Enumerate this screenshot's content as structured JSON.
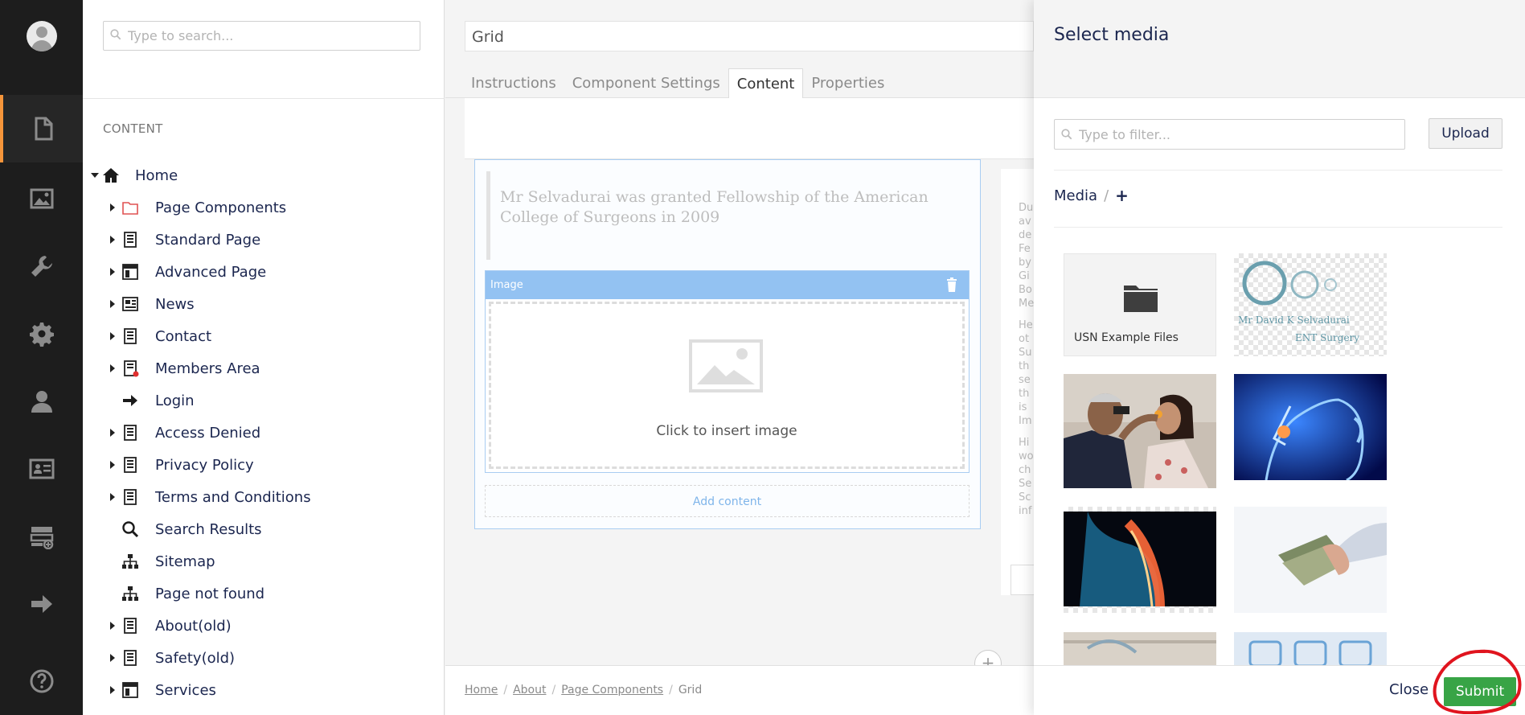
{
  "rail": {
    "items": [
      {
        "name": "content",
        "icon": "document-icon",
        "active": true
      },
      {
        "name": "media",
        "icon": "image-icon"
      },
      {
        "name": "settings",
        "icon": "wrench-icon"
      },
      {
        "name": "developer",
        "icon": "gear-icon"
      },
      {
        "name": "users",
        "icon": "user-icon"
      },
      {
        "name": "members",
        "icon": "id-card-icon"
      },
      {
        "name": "forms",
        "icon": "form-add-icon"
      },
      {
        "name": "redirects",
        "icon": "arrow-right-icon"
      },
      {
        "name": "help",
        "icon": "help-icon"
      }
    ],
    "accent_color": "#f5953a"
  },
  "tree": {
    "search_placeholder": "Type to search...",
    "heading": "CONTENT",
    "items": [
      {
        "label": "Home",
        "icon": "home-icon",
        "expanded": true
      },
      {
        "label": "Page Components",
        "icon": "folder-icon"
      },
      {
        "label": "Standard Page",
        "icon": "page-icon"
      },
      {
        "label": "Advanced Page",
        "icon": "layout-icon"
      },
      {
        "label": "News",
        "icon": "newspaper-icon"
      },
      {
        "label": "Contact",
        "icon": "page-icon"
      },
      {
        "label": "Members Area",
        "icon": "page-locked-icon"
      },
      {
        "label": "Login",
        "icon": "arrow-right-icon"
      },
      {
        "label": "Access Denied",
        "icon": "page-icon"
      },
      {
        "label": "Privacy Policy",
        "icon": "page-icon"
      },
      {
        "label": "Terms and Conditions",
        "icon": "page-icon"
      },
      {
        "label": "Search Results",
        "icon": "search-icon"
      },
      {
        "label": "Sitemap",
        "icon": "sitemap-icon"
      },
      {
        "label": "Page not found",
        "icon": "sitemap-icon"
      },
      {
        "label": "About(old)",
        "icon": "page-icon"
      },
      {
        "label": "Safety(old)",
        "icon": "page-icon"
      },
      {
        "label": "Services",
        "icon": "layout-icon"
      }
    ]
  },
  "editor": {
    "name_value": "Grid",
    "tabs": [
      "Instructions",
      "Component Settings",
      "Content",
      "Properties"
    ],
    "active_tab": "Content",
    "quote_text": "Mr Selvadurai was granted Fellowship of the American College of Surgeons in 2009",
    "image_control_title": "Image",
    "insert_image_label": "Click to insert image",
    "add_content_label": "Add content",
    "side_fragments": [
      "Du",
      "av",
      "de",
      "Fe",
      "by",
      "Gi",
      "Bo",
      "Me",
      "",
      "He",
      "ot",
      "Su",
      "th",
      "se",
      "th",
      "is",
      "Im",
      "",
      "Hi",
      "wo",
      "ch",
      "Se",
      "Sc",
      "inf"
    ],
    "breadcrumb": [
      "Home",
      "About",
      "Page Components",
      "Grid"
    ]
  },
  "picker": {
    "title": "Select media",
    "filter_placeholder": "Type to filter...",
    "upload_label": "Upload",
    "crumb_root": "Media",
    "crumb_add": "+",
    "items": [
      {
        "type": "folder",
        "name": "USN Example Files"
      },
      {
        "type": "image",
        "name": "ent-surgery-logo",
        "logo_line1": "Mr David K Selvadurai",
        "logo_line2": "ENT Surgery"
      },
      {
        "type": "image",
        "name": "doctor-examining-child"
      },
      {
        "type": "image",
        "name": "nasal-anatomy-xray"
      },
      {
        "type": "image",
        "name": "throat-anatomy-xray"
      },
      {
        "type": "image",
        "name": "hand-holding-cash"
      },
      {
        "type": "image",
        "name": "partial-image-7"
      },
      {
        "type": "image",
        "name": "partial-image-8"
      }
    ],
    "close_label": "Close",
    "submit_label": "Submit",
    "submit_color": "#38a446",
    "annotation_color": "#e0141e"
  }
}
